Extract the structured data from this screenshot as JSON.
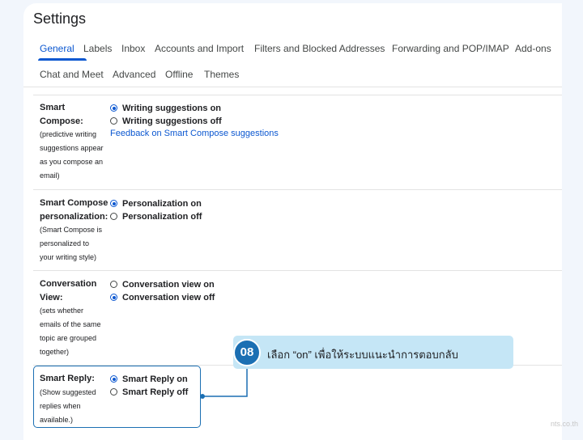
{
  "settings": {
    "title": "Settings",
    "tabs": [
      {
        "label": "General"
      },
      {
        "label": "Labels"
      },
      {
        "label": "Inbox"
      },
      {
        "label": "Accounts and Import"
      },
      {
        "label": "Filters and Blocked Addresses"
      },
      {
        "label": "Forwarding and POP/IMAP"
      },
      {
        "label": "Add-ons"
      },
      {
        "label": "Chat and Meet"
      },
      {
        "label": "Advanced"
      },
      {
        "label": "Offline"
      },
      {
        "label": "Themes"
      }
    ],
    "active_tab": "General"
  },
  "rows": {
    "smart_compose": {
      "title_line1": "Smart",
      "title_line2": "Compose:",
      "desc": [
        "(predictive writing",
        "suggestions appear",
        "as you compose an",
        "email)"
      ],
      "options": [
        {
          "label": "Writing suggestions on",
          "selected": true
        },
        {
          "label": "Writing suggestions off",
          "selected": false
        }
      ],
      "link": "Feedback on Smart Compose suggestions"
    },
    "personalization": {
      "title_line1": "Smart Compose",
      "title_line2": "personalization:",
      "desc": [
        "(Smart Compose is",
        "personalized to",
        "your writing style)"
      ],
      "options": [
        {
          "label": "Personalization on",
          "selected": true
        },
        {
          "label": "Personalization off",
          "selected": false
        }
      ]
    },
    "conversation_view": {
      "title_line1": "Conversation",
      "title_line2": "View:",
      "desc": [
        "(sets whether",
        "emails of the same",
        "topic are grouped",
        "together)"
      ],
      "options": [
        {
          "label": "Conversation view on",
          "selected": false
        },
        {
          "label": "Conversation view off",
          "selected": true
        }
      ]
    },
    "smart_reply": {
      "title_line1": "Smart Reply:",
      "desc": [
        "(Show suggested",
        "replies when",
        "available.)"
      ],
      "options": [
        {
          "label": "Smart Reply on",
          "selected": true
        },
        {
          "label": "Smart Reply off",
          "selected": false
        }
      ]
    }
  },
  "callout": {
    "step": "08",
    "text": "เลือก “on” เพื่อให้ระบบแนะนำการตอบกลับ"
  },
  "watermark": "nts.co.th",
  "colors": {
    "accent": "#0b57d0",
    "callout_bg": "#c5e6f6",
    "badge": "#1b6fb3",
    "page_bg": "#f2f6fc"
  }
}
